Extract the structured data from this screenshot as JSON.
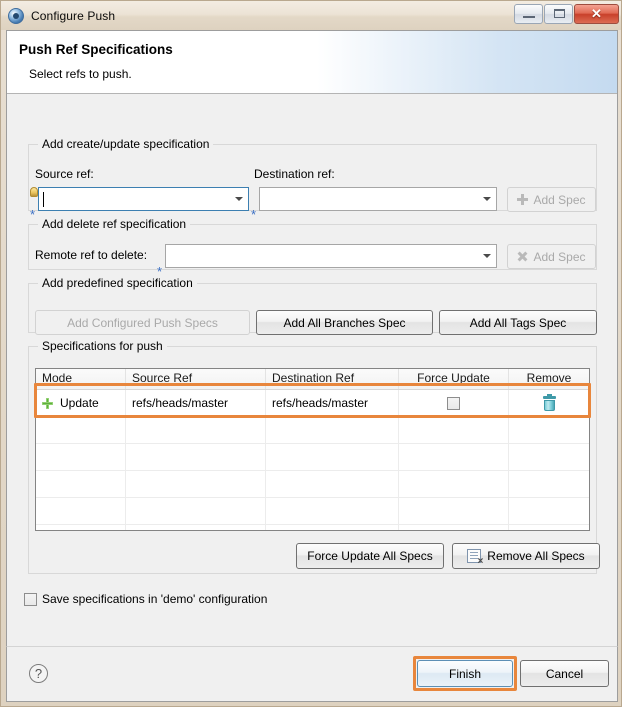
{
  "window": {
    "title": "Configure Push",
    "app_icon": "gear-disc-icon",
    "minimize_label": "",
    "maximize_label": "",
    "close_label": "✕"
  },
  "header": {
    "title": "Push Ref Specifications",
    "subtitle": "Select refs to push."
  },
  "create_update_group": {
    "title": "Add create/update specification",
    "source_label": "Source ref:",
    "source_value": "",
    "destination_label": "Destination ref:",
    "destination_value": "",
    "add_spec_label": "Add Spec",
    "add_spec_icon": "plus-icon",
    "required_marker": "*"
  },
  "delete_group": {
    "title": "Add delete ref specification",
    "remote_label": "Remote ref to delete:",
    "remote_value": "",
    "add_spec_label": "Add Spec",
    "add_spec_icon": "x-icon",
    "required_marker": "*"
  },
  "predefined_group": {
    "title": "Add predefined specification",
    "buttons": [
      {
        "label": "Add Configured Push Specs",
        "enabled": false
      },
      {
        "label": "Add All Branches Spec",
        "enabled": true
      },
      {
        "label": "Add All Tags Spec",
        "enabled": true
      }
    ]
  },
  "specs_group": {
    "title": "Specifications for push",
    "columns": [
      "Mode",
      "Source Ref",
      "Destination Ref",
      "Force Update",
      "Remove"
    ],
    "rows": [
      {
        "mode_icon": "plus-icon",
        "mode": "Update",
        "source_ref": "refs/heads/master",
        "destination_ref": "refs/heads/master",
        "force_update": false,
        "remove_icon": "trash-icon"
      }
    ],
    "empty_row_count": 5,
    "force_update_all_label": "Force Update All Specs",
    "remove_all_label": "Remove All Specs",
    "remove_all_icon": "document-x-icon"
  },
  "save_option": {
    "label": "Save specifications in 'demo' configuration",
    "checked": false
  },
  "footer": {
    "help_icon": "question-mark-icon",
    "finish_label": "Finish",
    "cancel_label": "Cancel"
  },
  "highlight_color": "#e8863c"
}
